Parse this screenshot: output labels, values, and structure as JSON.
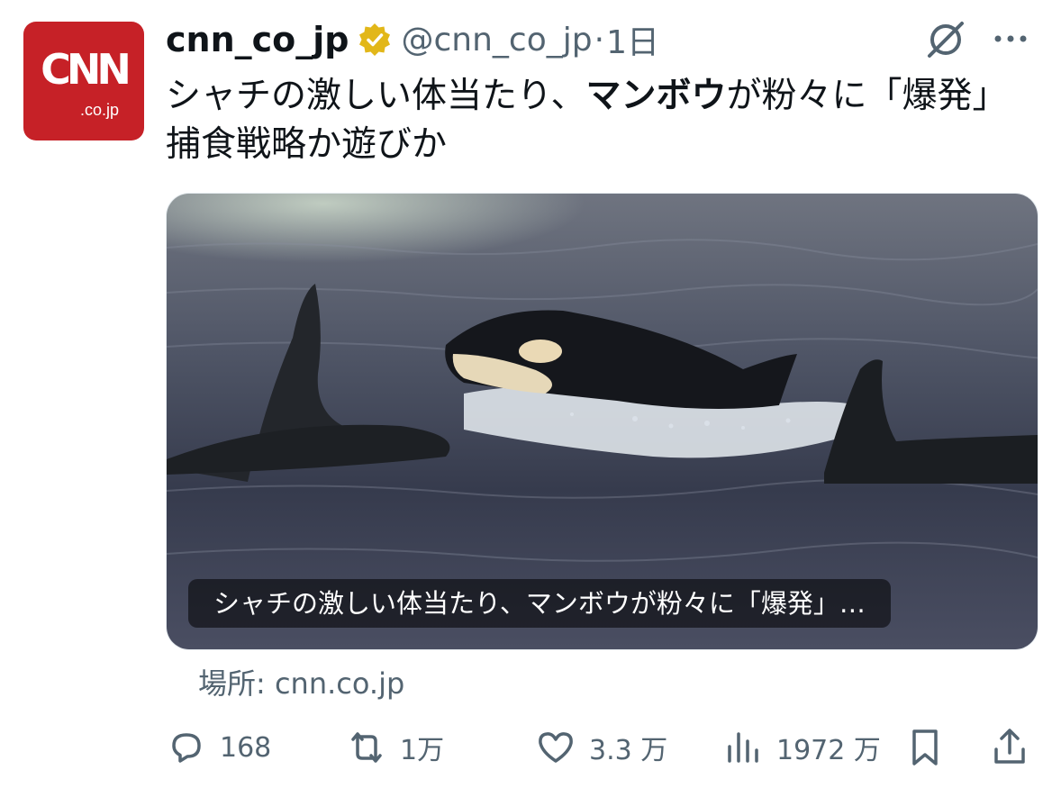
{
  "post": {
    "avatar_text": "CNN",
    "avatar_sub": ".co.jp",
    "author_name": "cnn_co_jp",
    "handle": "@cnn_co_jp",
    "separator": "·",
    "timestamp": "1日",
    "text_part1": "シャチの激しい体当たり、",
    "text_bold": "マンボウ",
    "text_part2": "が粉々に「爆発」　捕食戦略か遊びか"
  },
  "card": {
    "caption": "シャチの激しい体当たり、マンボウが粉々に「爆発」…",
    "source": "場所: cnn.co.jp"
  },
  "actions": {
    "replies": "168",
    "reposts": "1万",
    "likes": "3.3 万",
    "views": "1972 万"
  },
  "colors": {
    "brand_red": "#c62127",
    "verified_gold": "#e2b719",
    "secondary_text": "#536471"
  },
  "icons": [
    "verified-badge-icon",
    "grok-icon",
    "more-icon",
    "reply-icon",
    "repost-icon",
    "like-icon",
    "views-icon",
    "bookmark-icon",
    "share-icon"
  ]
}
